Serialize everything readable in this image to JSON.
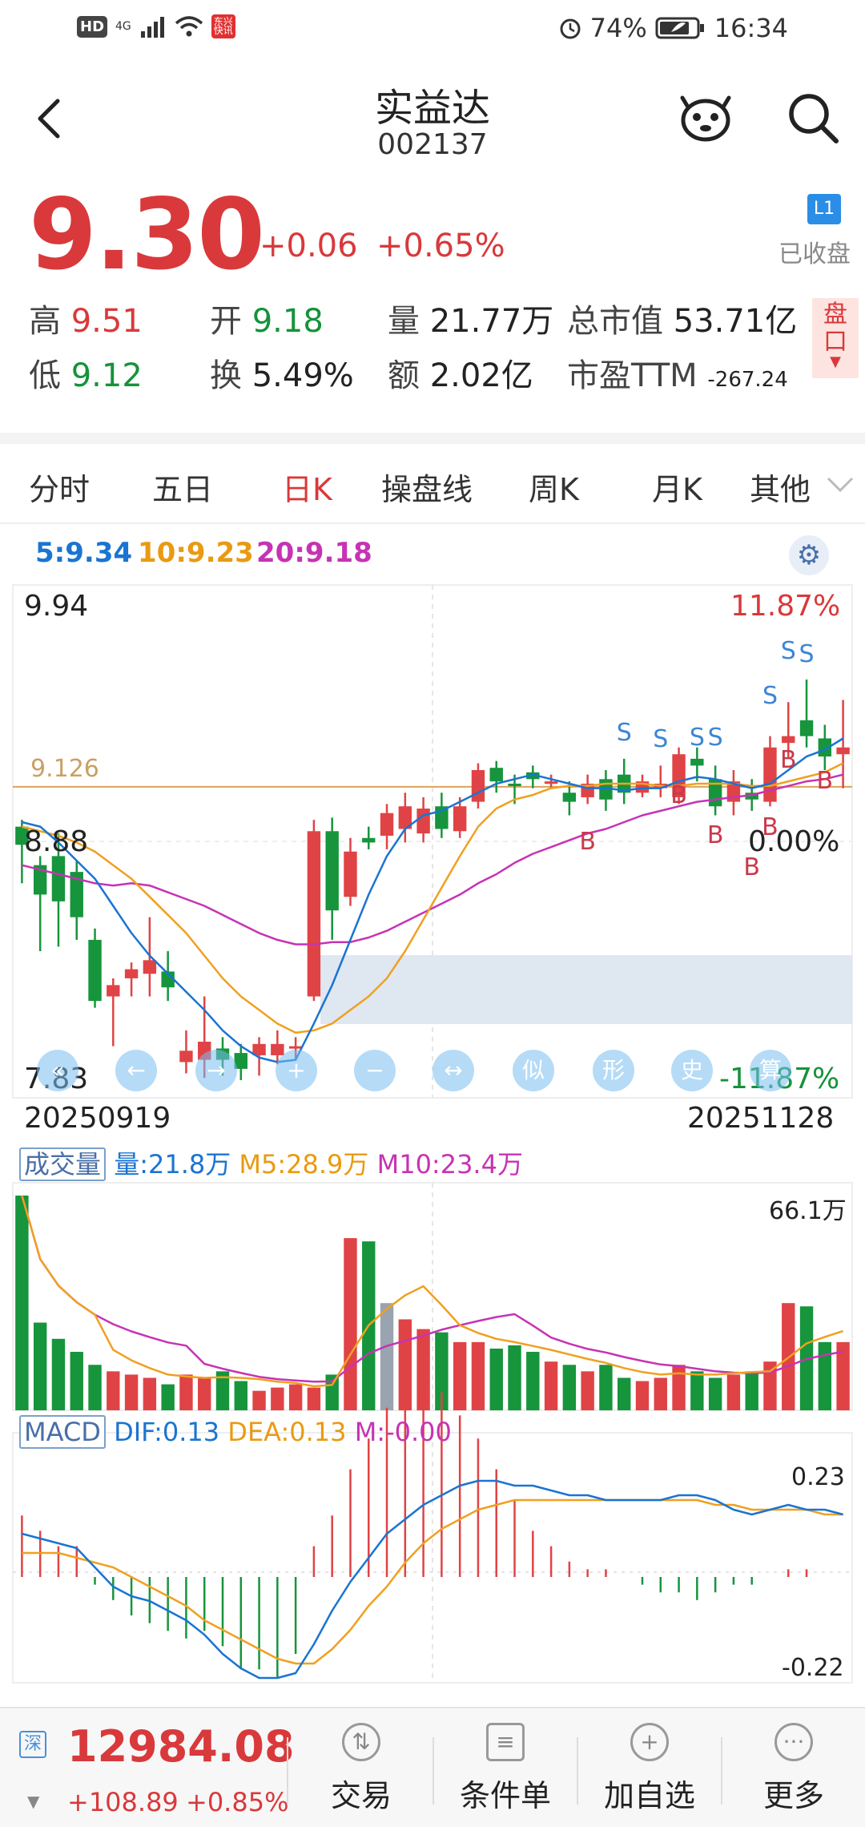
{
  "status_bar": {
    "hd": "HD",
    "network": "4G",
    "battery": "74%",
    "time": "16:34",
    "app_badge": "东兴 快讯"
  },
  "header": {
    "name": "实益达",
    "code": "002137"
  },
  "quote": {
    "price": "9.30",
    "change": "+0.06",
    "change_pct": "+0.65%",
    "level_badge": "L1",
    "market_status": "已收盘",
    "stats": [
      {
        "label": "高",
        "value": "9.51",
        "color": "red"
      },
      {
        "label": "开",
        "value": "9.18",
        "color": "green"
      },
      {
        "label": "量",
        "value": "21.77万",
        "color": "dark"
      },
      {
        "label": "总市值",
        "value": "53.71亿",
        "color": "dark"
      },
      {
        "label": "低",
        "value": "9.12",
        "color": "green"
      },
      {
        "label": "换",
        "value": "5.49%",
        "color": "dark"
      },
      {
        "label": "额",
        "value": "2.02亿",
        "color": "dark"
      },
      {
        "label": "市盈TTM",
        "value": "-267.24",
        "color": "dark"
      }
    ],
    "pankou": "盘口"
  },
  "tabs": [
    "分时",
    "五日",
    "日K",
    "操盘线",
    "周K",
    "月K",
    "其他"
  ],
  "active_tab": "日K",
  "ma_legend": {
    "ma5": "5:9.34",
    "ma10": "10:9.23",
    "ma20": "20:9.18"
  },
  "kline": {
    "y_high": "9.94",
    "y_mid": "8.88",
    "y_low": "7.83",
    "ref_price": "9.126",
    "pct_high": "11.87%",
    "pct_mid": "0.00%",
    "pct_low": "-11.87%",
    "date_start": "20250919",
    "date_end": "20251128",
    "overlay_buttons": [
      "«",
      "←",
      "→",
      "+",
      "−",
      "↔",
      "似",
      "形",
      "史",
      "算"
    ]
  },
  "volume": {
    "title": "成交量",
    "vol": "量:21.8万",
    "m5": "M5:28.9万",
    "m10": "M10:23.4万",
    "max": "66.1万"
  },
  "macd": {
    "title": "MACD",
    "dif": "DIF:0.13",
    "dea": "DEA:0.13",
    "m": "M:-0.00",
    "max": "0.23",
    "min": "-0.22"
  },
  "index": {
    "badge": "深",
    "value": "12984.08",
    "change": "+108.89",
    "change_pct": "+0.85%"
  },
  "bottom_nav": [
    {
      "label": "交易",
      "icon": "trade-icon"
    },
    {
      "label": "条件单",
      "icon": "condition-order-icon"
    },
    {
      "label": "加自选",
      "icon": "add-watchlist-icon"
    },
    {
      "label": "更多",
      "icon": "more-icon"
    }
  ],
  "chart_data": {
    "type": "candlestick",
    "candles": [
      [
        8.95,
        8.87,
        8.98,
        8.7
      ],
      [
        8.78,
        8.65,
        8.82,
        8.4
      ],
      [
        8.82,
        8.62,
        8.92,
        8.42
      ],
      [
        8.75,
        8.55,
        8.8,
        8.45
      ],
      [
        8.45,
        8.18,
        8.5,
        8.15
      ],
      [
        8.2,
        8.25,
        8.28,
        7.98
      ],
      [
        8.28,
        8.32,
        8.35,
        8.2
      ],
      [
        8.3,
        8.36,
        8.55,
        8.2
      ],
      [
        8.31,
        8.24,
        8.4,
        8.18
      ],
      [
        7.91,
        7.96,
        8.05,
        7.86
      ],
      [
        7.92,
        8.0,
        8.2,
        7.84
      ],
      [
        7.97,
        7.92,
        8.02,
        7.85
      ],
      [
        7.95,
        7.88,
        7.99,
        7.83
      ],
      [
        7.94,
        7.99,
        8.02,
        7.85
      ],
      [
        7.94,
        7.99,
        8.05,
        7.9
      ],
      [
        7.97,
        7.98,
        8.02,
        7.92
      ],
      [
        8.2,
        8.93,
        8.98,
        8.18
      ],
      [
        8.93,
        8.58,
        8.99,
        8.45
      ],
      [
        8.64,
        8.84,
        8.9,
        8.6
      ],
      [
        8.9,
        8.88,
        8.95,
        8.85
      ],
      [
        8.91,
        9.01,
        9.05,
        8.85
      ],
      [
        8.94,
        9.04,
        9.1,
        8.88
      ],
      [
        8.92,
        9.03,
        9.08,
        8.88
      ],
      [
        9.04,
        8.94,
        9.1,
        8.9
      ],
      [
        8.93,
        9.04,
        9.08,
        8.9
      ],
      [
        9.06,
        9.2,
        9.23,
        9.03
      ],
      [
        9.21,
        9.15,
        9.24,
        9.1
      ],
      [
        9.14,
        9.13,
        9.18,
        9.05
      ],
      [
        9.19,
        9.16,
        9.22,
        9.12
      ],
      [
        9.15,
        9.15,
        9.18,
        9.12
      ],
      [
        9.1,
        9.06,
        9.15,
        9.0
      ],
      [
        9.08,
        9.14,
        9.18,
        9.05
      ],
      [
        9.16,
        9.07,
        9.2,
        9.02
      ],
      [
        9.18,
        9.1,
        9.25,
        9.05
      ],
      [
        9.1,
        9.15,
        9.18,
        9.08
      ],
      [
        9.12,
        9.14,
        9.22,
        9.08
      ],
      [
        9.08,
        9.27,
        9.3,
        9.05
      ],
      [
        9.25,
        9.22,
        9.3,
        9.15
      ],
      [
        9.16,
        9.04,
        9.22,
        9.0
      ],
      [
        9.06,
        9.15,
        9.2,
        9.0
      ],
      [
        9.1,
        9.07,
        9.16,
        9.02
      ],
      [
        9.06,
        9.3,
        9.35,
        9.04
      ],
      [
        9.32,
        9.35,
        9.5,
        9.25
      ],
      [
        9.42,
        9.35,
        9.6,
        9.3
      ],
      [
        9.34,
        9.26,
        9.4,
        9.2
      ],
      [
        9.27,
        9.3,
        9.51,
        9.12
      ]
    ],
    "ma5": [
      8.97,
      8.95,
      8.88,
      8.8,
      8.72,
      8.6,
      8.48,
      8.38,
      8.3,
      8.22,
      8.14,
      8.05,
      7.98,
      7.93,
      7.91,
      7.92,
      8.08,
      8.25,
      8.45,
      8.65,
      8.82,
      8.94,
      9.0,
      9.02,
      9.06,
      9.1,
      9.14,
      9.16,
      9.18,
      9.16,
      9.14,
      9.12,
      9.12,
      9.11,
      9.12,
      9.12,
      9.15,
      9.17,
      9.16,
      9.14,
      9.12,
      9.14,
      9.2,
      9.26,
      9.29,
      9.34
    ],
    "ma10": [
      8.95,
      8.93,
      8.91,
      8.88,
      8.84,
      8.78,
      8.72,
      8.64,
      8.56,
      8.48,
      8.38,
      8.28,
      8.2,
      8.14,
      8.08,
      8.04,
      8.05,
      8.08,
      8.14,
      8.2,
      8.28,
      8.4,
      8.54,
      8.68,
      8.82,
      8.95,
      9.03,
      9.07,
      9.09,
      9.12,
      9.13,
      9.13,
      9.14,
      9.14,
      9.14,
      9.13,
      9.13,
      9.14,
      9.14,
      9.14,
      9.13,
      9.13,
      9.15,
      9.17,
      9.19,
      9.23
    ],
    "ma20": [
      8.78,
      8.76,
      8.74,
      8.72,
      8.7,
      8.69,
      8.7,
      8.69,
      8.66,
      8.63,
      8.6,
      8.56,
      8.52,
      8.48,
      8.45,
      8.43,
      8.43,
      8.44,
      8.44,
      8.46,
      8.49,
      8.53,
      8.57,
      8.61,
      8.65,
      8.7,
      8.74,
      8.79,
      8.83,
      8.86,
      8.89,
      8.92,
      8.94,
      8.97,
      9.0,
      9.02,
      9.04,
      9.06,
      9.07,
      9.08,
      9.09,
      9.11,
      9.13,
      9.15,
      9.16,
      9.18
    ],
    "volume": [
      66.1,
      27,
      22,
      18,
      14,
      12,
      11,
      10,
      8,
      11,
      10,
      12,
      9,
      6,
      7,
      8,
      7,
      11,
      53,
      52,
      33,
      28,
      25,
      24,
      21,
      21,
      19,
      20,
      18,
      15,
      14,
      12,
      14,
      10,
      9,
      10,
      14,
      12,
      10,
      11,
      12,
      15,
      33,
      32,
      21,
      21
    ],
    "macd_dif": [
      0.09,
      0.08,
      0.07,
      0.06,
      0.02,
      -0.02,
      -0.04,
      -0.05,
      -0.07,
      -0.09,
      -0.12,
      -0.16,
      -0.19,
      -0.21,
      -0.21,
      -0.2,
      -0.14,
      -0.07,
      -0.01,
      0.04,
      0.09,
      0.12,
      0.15,
      0.17,
      0.19,
      0.2,
      0.2,
      0.19,
      0.19,
      0.18,
      0.17,
      0.17,
      0.16,
      0.16,
      0.16,
      0.16,
      0.17,
      0.17,
      0.16,
      0.14,
      0.13,
      0.14,
      0.15,
      0.14,
      0.14,
      0.13
    ],
    "macd_dea": [
      0.05,
      0.05,
      0.05,
      0.04,
      0.03,
      0.02,
      0.0,
      -0.02,
      -0.04,
      -0.06,
      -0.09,
      -0.11,
      -0.13,
      -0.15,
      -0.17,
      -0.18,
      -0.18,
      -0.15,
      -0.11,
      -0.06,
      -0.02,
      0.03,
      0.07,
      0.1,
      0.12,
      0.14,
      0.15,
      0.16,
      0.16,
      0.16,
      0.16,
      0.16,
      0.16,
      0.16,
      0.16,
      0.16,
      0.16,
      0.16,
      0.15,
      0.15,
      0.14,
      0.14,
      0.14,
      0.14,
      0.13,
      0.13
    ],
    "macd_hist": [
      0.08,
      0.06,
      0.04,
      0.04,
      -0.01,
      -0.03,
      -0.05,
      -0.06,
      -0.07,
      -0.08,
      -0.07,
      -0.09,
      -0.12,
      -0.12,
      -0.13,
      -0.1,
      0.04,
      0.08,
      0.14,
      0.18,
      0.22,
      0.24,
      0.25,
      0.24,
      0.21,
      0.18,
      0.14,
      0.1,
      0.06,
      0.04,
      0.02,
      0.01,
      0.01,
      0.0,
      -0.01,
      -0.02,
      -0.02,
      -0.03,
      -0.02,
      -0.01,
      -0.01,
      0.0,
      0.01,
      0.01,
      0.0,
      0.0
    ]
  }
}
